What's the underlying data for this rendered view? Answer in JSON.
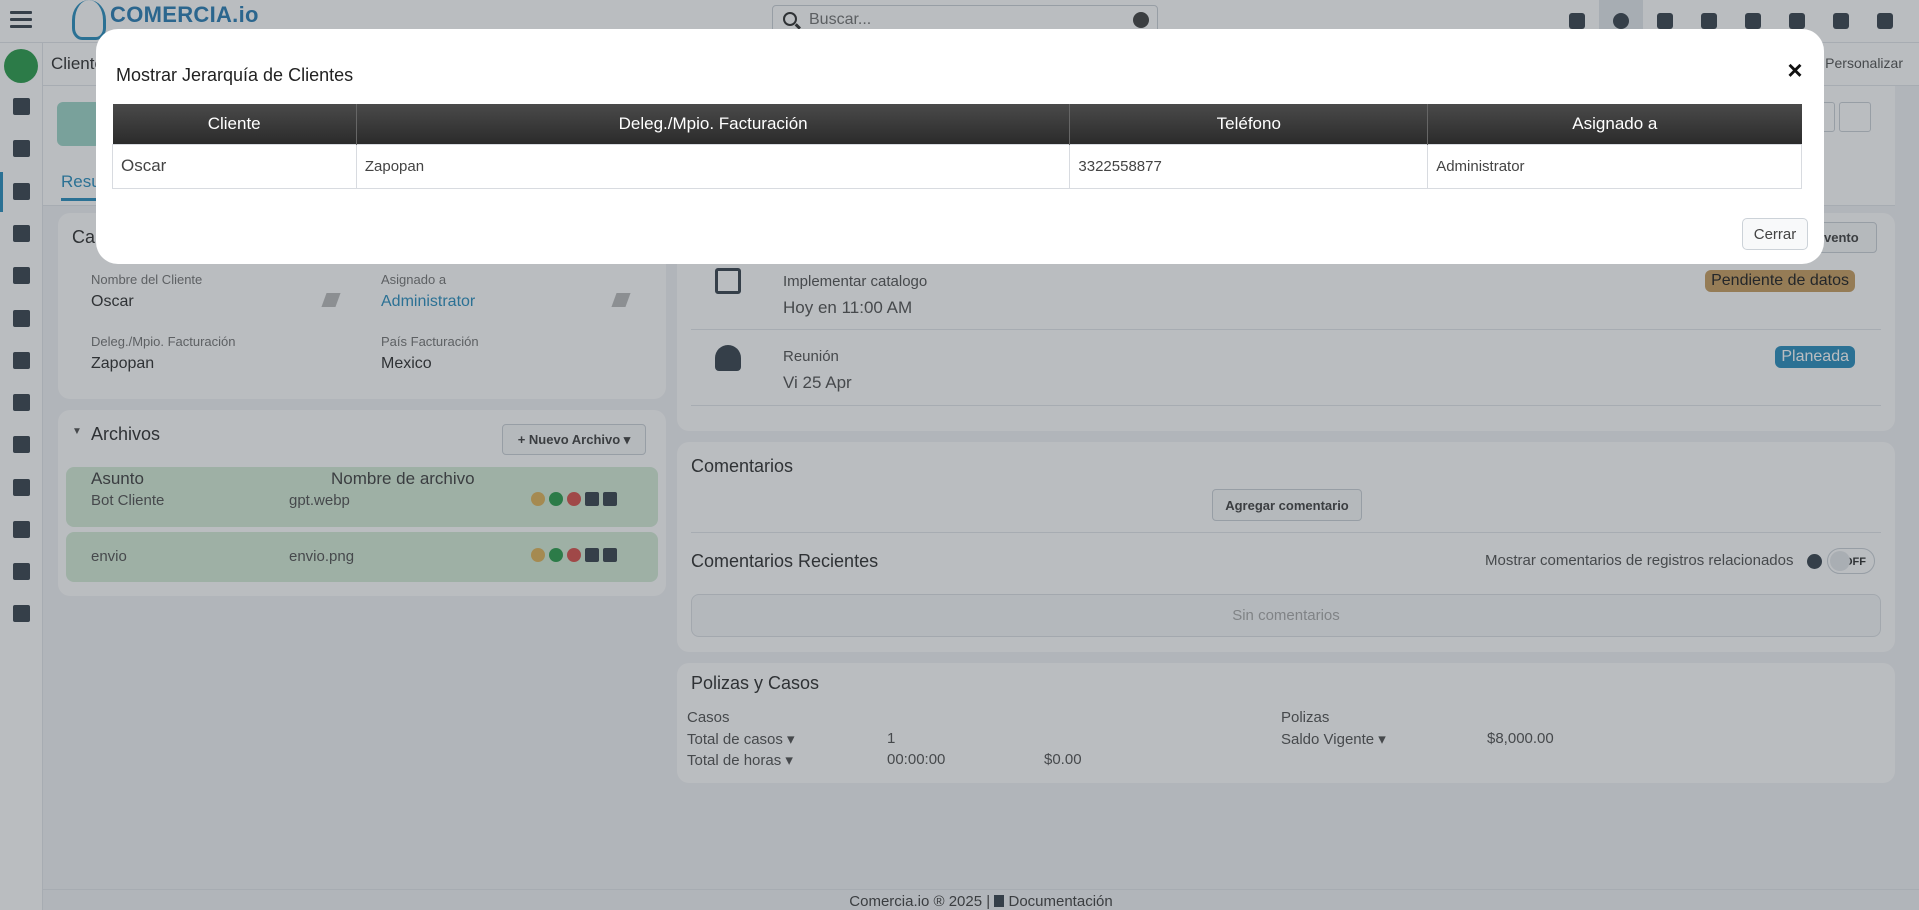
{
  "app": {
    "brand": "COMERCIA.io",
    "search_placeholder": "Buscar..."
  },
  "subbar": {
    "breadcrumb": "Cliente",
    "personalize": "Personalizar"
  },
  "header": {
    "active_tab": "Resu"
  },
  "info_card": {
    "title": "Ca",
    "fields": [
      {
        "label": "Nombre del Cliente",
        "value": "Oscar"
      },
      {
        "label": "Asignado a",
        "value": "Administrator"
      },
      {
        "label": "Deleg./Mpio. Facturación",
        "value": "Zapopan"
      },
      {
        "label": "País Facturación",
        "value": "Mexico"
      }
    ]
  },
  "files_card": {
    "title": "Archivos",
    "new_button": "Nuevo Archivo",
    "col_subject": "Asunto",
    "col_filename": "Nombre de archivo",
    "rows": [
      {
        "subject": "Bot Cliente",
        "filename": "gpt.webp"
      },
      {
        "subject": "envio",
        "filename": "envio.png"
      }
    ]
  },
  "activities": {
    "new_event_button": "Evento",
    "items": [
      {
        "title": "Implementar catalogo",
        "when": "Hoy en 11:00 AM",
        "status": "Pendiente de datos",
        "icon": "checkbox-icon",
        "status_color": "#c9a063"
      },
      {
        "title": "Reunión",
        "when": "Vi 25 Apr",
        "status": "Planeada",
        "icon": "people-icon",
        "status_color": "#2d8fbf"
      }
    ]
  },
  "comments": {
    "title": "Comentarios",
    "add_button": "Agregar comentario",
    "recent_title": "Comentarios Recientes",
    "related_label": "Mostrar comentarios de registros relacionados",
    "toggle_state": "OFF",
    "empty_text": "Sin comentarios"
  },
  "policies": {
    "title": "Polizas y Casos",
    "cases_label": "Casos",
    "total_cases_label": "Total de casos",
    "total_cases_value": "1",
    "total_hours_label": "Total de horas",
    "total_hours_value": "00:00:00",
    "total_hours_amount": "$0.00",
    "policies_label": "Polizas",
    "balance_label": "Saldo Vigente",
    "balance_value": "$8,000.00"
  },
  "footer": {
    "copyright": "Comercia.io ® 2025",
    "separator": "|",
    "docs_link": "Documentación"
  },
  "modal": {
    "title": "Mostrar Jerarquía de Clientes",
    "close_icon": "×",
    "close_button": "Cerrar",
    "columns": [
      "Cliente",
      "Deleg./Mpio. Facturación",
      "Teléfono",
      "Asignado a"
    ],
    "rows": [
      [
        "Oscar",
        "Zapopan",
        "3322558877",
        "Administrator"
      ]
    ]
  },
  "colors": {
    "accent": "#2d8fbf",
    "success": "#2f9e4f",
    "warning_badge": "#c9a063"
  }
}
